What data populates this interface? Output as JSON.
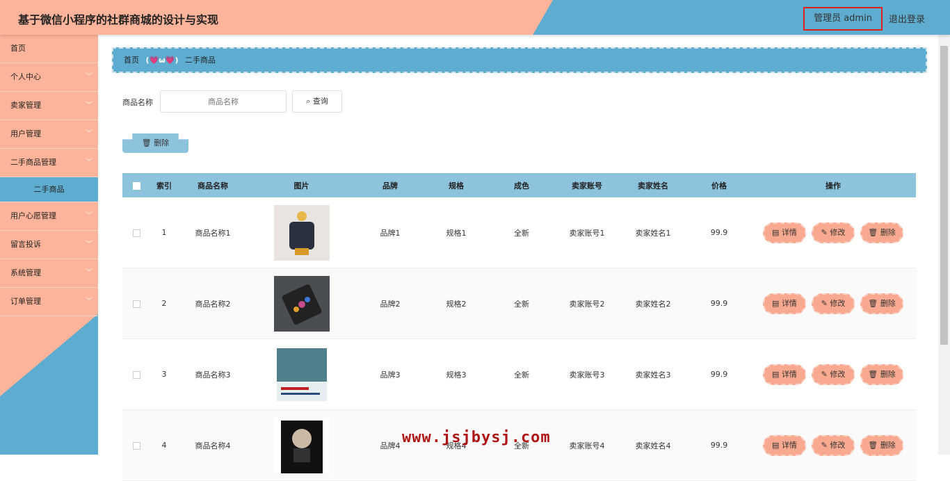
{
  "header": {
    "title": "基于微信小程序的社群商城的设计与实现",
    "admin_label": "管理员 admin",
    "logout_label": "退出登录"
  },
  "sidebar": {
    "items": [
      {
        "label": "首页",
        "icon": "none"
      },
      {
        "label": "个人中心",
        "icon": "chevron-down-icon"
      },
      {
        "label": "卖家管理",
        "icon": "chevron-down-icon"
      },
      {
        "label": "用户管理",
        "icon": "chevron-down-icon"
      },
      {
        "label": "二手商品管理",
        "icon": "chevron-down-icon"
      },
      {
        "label": "二手商品",
        "icon": "none"
      },
      {
        "label": "用户心愿管理",
        "icon": "chevron-down-icon"
      },
      {
        "label": "留言投诉",
        "icon": "chevron-down-icon"
      },
      {
        "label": "系统管理",
        "icon": "chevron-down-icon"
      },
      {
        "label": "订单管理",
        "icon": "chevron-down-icon"
      }
    ]
  },
  "breadcrumb": {
    "home": "首页",
    "separator": "(💗ω💗)",
    "current": "二手商品"
  },
  "search": {
    "label": "商品名称",
    "placeholder": "商品名称",
    "button_label": "查询"
  },
  "toolbar": {
    "delete_label": "删除"
  },
  "table": {
    "columns": [
      "索引",
      "商品名称",
      "图片",
      "品牌",
      "规格",
      "成色",
      "卖家账号",
      "卖家姓名",
      "价格",
      "操作"
    ],
    "rows": [
      {
        "index": "1",
        "name": "商品名称1",
        "brand": "品牌1",
        "spec": "规格1",
        "condition": "全新",
        "account": "卖家账号1",
        "seller": "卖家姓名1",
        "price": "99.9"
      },
      {
        "index": "2",
        "name": "商品名称2",
        "brand": "品牌2",
        "spec": "规格2",
        "condition": "全新",
        "account": "卖家账号2",
        "seller": "卖家姓名2",
        "price": "99.9"
      },
      {
        "index": "3",
        "name": "商品名称3",
        "brand": "品牌3",
        "spec": "规格3",
        "condition": "全新",
        "account": "卖家账号3",
        "seller": "卖家姓名3",
        "price": "99.9"
      },
      {
        "index": "4",
        "name": "商品名称4",
        "brand": "品牌4",
        "spec": "规格4",
        "condition": "全新",
        "account": "卖家账号4",
        "seller": "卖家姓名4",
        "price": "99.9"
      }
    ],
    "ops": {
      "detail": "详情",
      "edit": "修改",
      "delete": "删除"
    }
  },
  "watermark": "www.jsjbysj.com",
  "colors": {
    "peach": "#fdb49a",
    "blue": "#5eaccf",
    "light_blue": "#8ec3dd",
    "accent_red": "#e02020"
  }
}
